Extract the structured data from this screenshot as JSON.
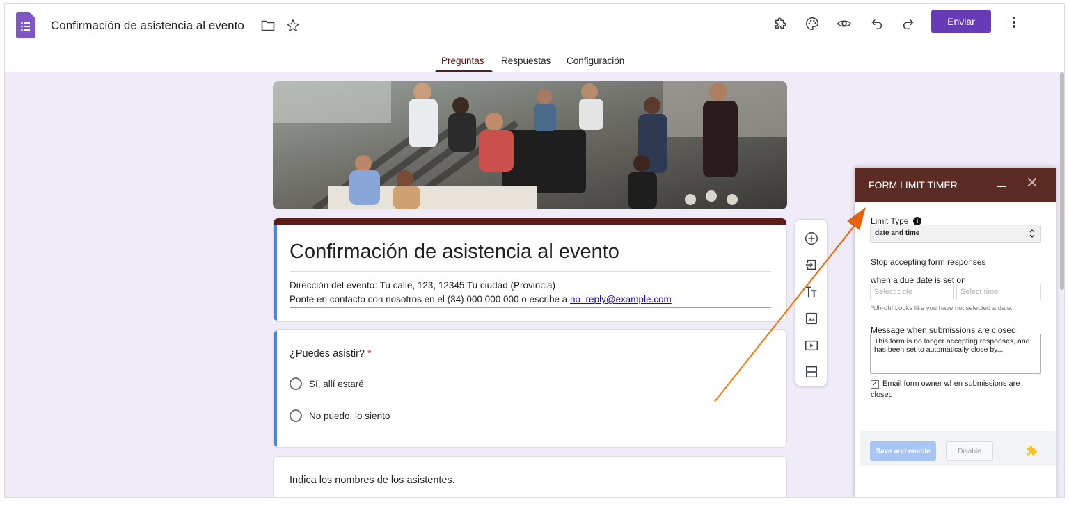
{
  "app": {
    "doc_title": "Confirmación de asistencia al evento",
    "send_label": "Enviar",
    "icons": [
      "puzzle-icon",
      "palette-icon",
      "preview-eye-icon",
      "undo-icon",
      "redo-icon",
      "more-vert-icon"
    ]
  },
  "tabs": [
    {
      "label": "Preguntas",
      "active": true
    },
    {
      "label": "Respuestas",
      "active": false
    },
    {
      "label": "Configuración",
      "active": false
    }
  ],
  "form": {
    "title": "Confirmación de asistencia al evento",
    "description_line1": "Dirección del evento: Tu calle, 123, 12345 Tu ciudad (Provincia)",
    "description_line2_prefix": "Ponte en contacto con nosotros en el (34) 000 000 000 o escribe a ",
    "description_email": "no_reply@example.com",
    "question": {
      "title": "¿Puedes asistir?",
      "required_mark": "*",
      "options": [
        "Sí, allí estaré",
        "No puedo, lo siento"
      ]
    },
    "next_question_title": "Indica los nombres de los asistentes."
  },
  "side_toolbar": [
    "add-question-icon",
    "import-questions-icon",
    "add-title-icon",
    "add-image-icon",
    "add-video-icon",
    "add-section-icon"
  ],
  "form_limit_timer": {
    "title": "FORM LIMIT TIMER",
    "close_glyph": "✕",
    "limit_type_label": "Limit Type",
    "info_glyph": "i",
    "limit_type_value": "date and time",
    "stop_label": "Stop accepting form responses",
    "due_label": "when a due date is set on",
    "date_placeholder": "Select date",
    "time_placeholder": "Select time",
    "warning": "*Uh-oh! Looks like you have not selected a date.",
    "message_label": "Message when submissions are closed",
    "message_value": "This form is no longer accepting responses, and has been set to automatically close by...",
    "email_checkbox_label": "Email form owner when submissions are closed",
    "email_checkbox_checked": true,
    "save_label": "Save and enable",
    "disable_label": "Disable"
  },
  "colors": {
    "brand_purple": "#673ab7",
    "theme_maroon": "#5c2b24",
    "accent_blue": "#4285f4",
    "annotation_arrow": "#f28a1e"
  }
}
